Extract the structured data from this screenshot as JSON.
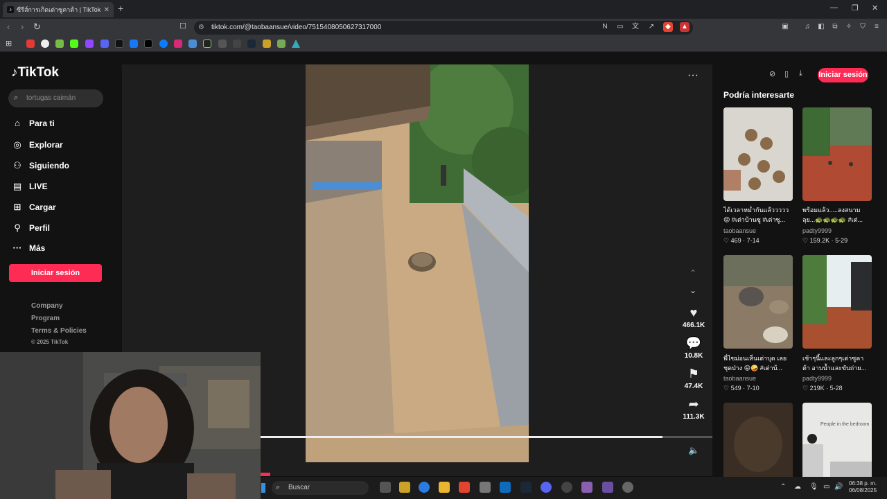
{
  "browser": {
    "tab_title": "ซีรีส์การเกิดเต่าซูคาต้า | TikTok",
    "url": "tiktok.com/@taobaansue/video/7515408050627317000"
  },
  "sidebar": {
    "logo": "TikTok",
    "search_placeholder": "tortugas caimán",
    "nav": [
      {
        "label": "Para ti",
        "icon": "home-icon"
      },
      {
        "label": "Explorar",
        "icon": "compass-icon"
      },
      {
        "label": "Siguiendo",
        "icon": "following-icon"
      },
      {
        "label": "LIVE",
        "icon": "live-icon"
      },
      {
        "label": "Cargar",
        "icon": "upload-icon"
      },
      {
        "label": "Perfil",
        "icon": "profile-icon"
      },
      {
        "label": "Más",
        "icon": "more-icon"
      }
    ],
    "login": "Iniciar sesión",
    "footer": [
      "Company",
      "Program",
      "Terms & Policies",
      "© 2025 TikTok"
    ]
  },
  "video": {
    "likes": "466.1K",
    "comments": "10.8K",
    "saves": "47.4K",
    "shares": "111.3K",
    "progress": 0.89
  },
  "right": {
    "login": "Iniciar sesión",
    "heading": "Podría interesarte",
    "items": [
      {
        "caption1": "ได้เวลาหม่ำกันแล้ววววว",
        "caption2": "😝 #เต่าบ้านซู #เต่าซู...",
        "author": "taobaansue",
        "likes": "469",
        "date": "7-14"
      },
      {
        "caption1": "พร้อมแล้ว.....ลงสนาม",
        "caption2": "ลุย...🐢🐢🐢🐢 #เต่...",
        "author": "padty9999",
        "likes": "159.2K",
        "date": "5-29"
      },
      {
        "caption1": "พี่ไซม่อนเห็นเต่าบุด เลย",
        "caption2": "ชุดป่าง 😝🤪 #เต่าบ้...",
        "author": "taobaansue",
        "likes": "549",
        "date": "7-10"
      },
      {
        "caption1": "เช้าๆนี้และลูกๆเต่าซูคา",
        "caption2": "ต้า อาบน้ำและขับถ่าย...",
        "author": "padty9999",
        "likes": "219K",
        "date": "5-28"
      }
    ],
    "thumb_text": "People in the bedroom"
  },
  "taskbar": {
    "search": "Buscar",
    "time": "06:38 p. m.",
    "date": "06/08/2025"
  }
}
